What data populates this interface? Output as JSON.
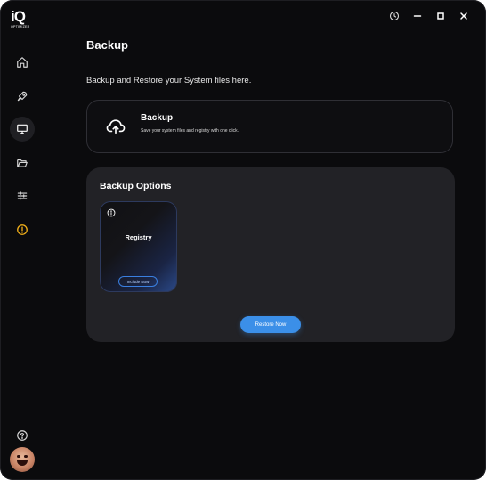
{
  "app": {
    "logo_text": "iQ",
    "logo_subtext": "OPTIMIZER"
  },
  "sidebar": {
    "items": [
      {
        "name": "home",
        "icon": "home-icon",
        "active": false
      },
      {
        "name": "boost",
        "icon": "rocket-icon",
        "active": false
      },
      {
        "name": "system",
        "icon": "monitor-icon",
        "active": true
      },
      {
        "name": "files",
        "icon": "folder-open-icon",
        "active": false
      },
      {
        "name": "tweaks",
        "icon": "sliders-icon",
        "active": false
      },
      {
        "name": "alerts",
        "icon": "alert-circle-icon",
        "active": false
      }
    ],
    "help_icon": "help-circle-icon",
    "avatar": "user-avatar"
  },
  "titlebar": {
    "icons": [
      "history-icon",
      "minimize-icon",
      "maximize-icon",
      "close-icon"
    ]
  },
  "page": {
    "title": "Backup",
    "subtitle": "Backup and Restore your System files here."
  },
  "backup_card": {
    "title": "Backup",
    "description": "Save your system files and registry with one click.",
    "icon": "cloud-upload-icon"
  },
  "options": {
    "title": "Backup Options",
    "cards": [
      {
        "label": "Registry",
        "button": "Include Now",
        "icon": "info-icon"
      }
    ],
    "restore_button": "Restore Now"
  },
  "colors": {
    "background": "#0b0b0d",
    "panel": "#222226",
    "accent": "#3b8fe8",
    "alert": "#f5b21a"
  }
}
